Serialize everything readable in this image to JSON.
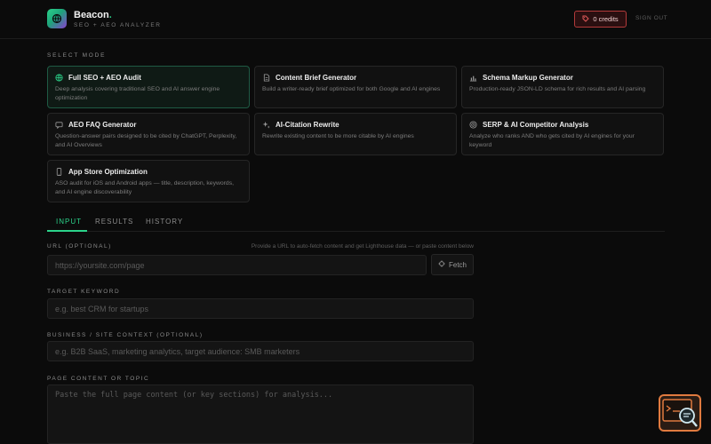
{
  "header": {
    "brand_name": "Beacon",
    "brand_dot": ".",
    "tagline": "SEO + AEO ANALYZER",
    "credits_label": "0 credits",
    "signout_label": "SIGN OUT"
  },
  "modes_label": "SELECT MODE",
  "modes": [
    {
      "title": "Full SEO + AEO Audit",
      "desc": "Deep analysis covering traditional SEO and AI answer engine optimization",
      "icon": "globe-icon",
      "active": true
    },
    {
      "title": "Content Brief Generator",
      "desc": "Build a writer-ready brief optimized for both Google and AI engines",
      "icon": "document-icon"
    },
    {
      "title": "Schema Markup Generator",
      "desc": "Production-ready JSON-LD schema for rich results and AI parsing",
      "icon": "chart-icon"
    },
    {
      "title": "AEO FAQ Generator",
      "desc": "Question-answer pairs designed to be cited by ChatGPT, Perplexity, and AI Overviews",
      "icon": "chat-icon"
    },
    {
      "title": "AI-Citation Rewrite",
      "desc": "Rewrite existing content to be more citable by AI engines",
      "icon": "sparkle-icon"
    },
    {
      "title": "SERP & AI Competitor Analysis",
      "desc": "Analyze who ranks AND who gets cited by AI engines for your keyword",
      "icon": "target-icon"
    },
    {
      "title": "App Store Optimization",
      "desc": "ASO audit for iOS and Android apps — title, description, keywords, and AI engine discoverability",
      "icon": "phone-icon"
    }
  ],
  "tabs": [
    {
      "label": "INPUT",
      "active": true
    },
    {
      "label": "RESULTS"
    },
    {
      "label": "HISTORY"
    }
  ],
  "form": {
    "url_label": "URL (OPTIONAL)",
    "url_hint": "Provide a URL to auto-fetch content and get Lighthouse data — or paste content below",
    "url_placeholder": "https://yoursite.com/page",
    "fetch_label": "Fetch",
    "keyword_label": "TARGET KEYWORD",
    "keyword_placeholder": "e.g. best CRM for startups",
    "context_label": "BUSINESS / SITE CONTEXT (OPTIONAL)",
    "context_placeholder": "e.g. B2B SaaS, marketing analytics, target audience: SMB marketers",
    "content_label": "PAGE CONTENT OR TOPIC",
    "content_placeholder": "Paste the full page content (or key sections) for analysis..."
  },
  "colors": {
    "accent": "#2bd38a",
    "danger": "#b23a3a",
    "background": "#0b0b0b"
  }
}
